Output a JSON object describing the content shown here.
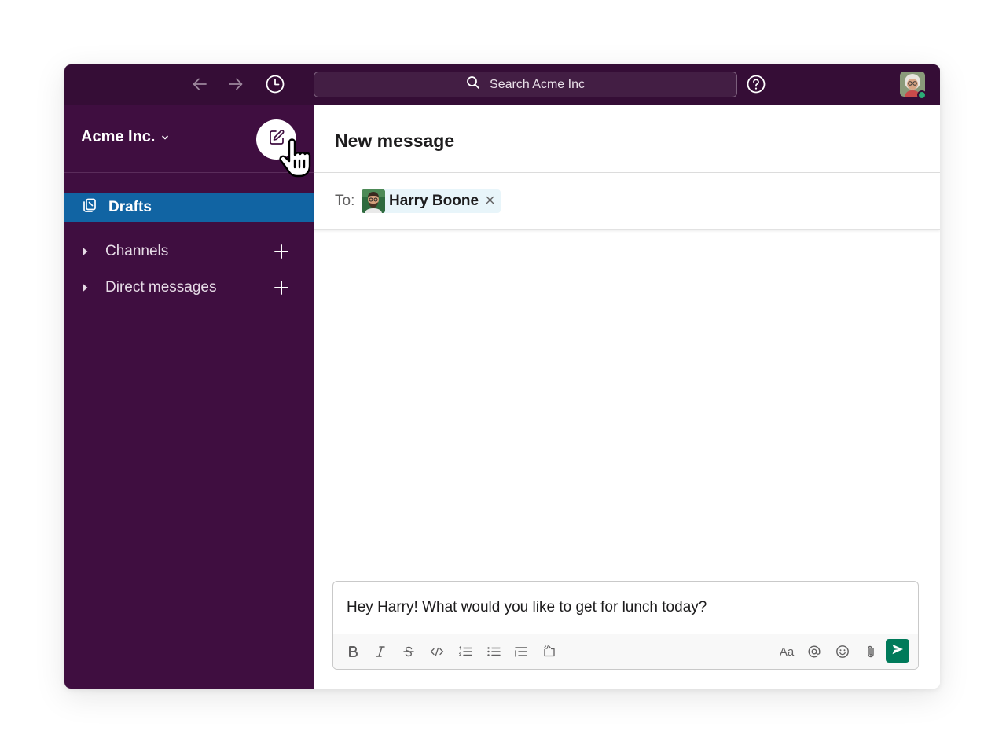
{
  "colors": {
    "topbar": "#350d36",
    "sidebar": "#3f0e40",
    "active_item": "#1164a3",
    "send_button": "#007a5a",
    "presence": "#2bac76",
    "chip_bg": "#e8f5fa"
  },
  "topbar": {
    "back_icon": "arrow-left-icon",
    "forward_icon": "arrow-right-icon",
    "history_icon": "clock-icon",
    "search_placeholder": "Search Acme Inc",
    "help_icon": "question-circle-icon",
    "user_status": "online"
  },
  "sidebar": {
    "workspace_name": "Acme Inc.",
    "compose_icon": "edit-icon",
    "active_item": {
      "label": "Drafts",
      "icon": "drafts-icon"
    },
    "sections": [
      {
        "label": "Channels",
        "expanded": false
      },
      {
        "label": "Direct messages",
        "expanded": false
      }
    ]
  },
  "main": {
    "title": "New message",
    "to_label": "To:",
    "recipient": {
      "name": "Harry Boone"
    },
    "composer": {
      "text": "Hey Harry! What would you like to get for lunch today?",
      "format_tools": [
        "bold-icon",
        "italic-icon",
        "strikethrough-icon",
        "code-icon",
        "ordered-list-icon",
        "bulleted-list-icon",
        "blockquote-icon",
        "code-block-icon"
      ],
      "format_toggle_label": "Aa",
      "right_tools": [
        "mention-icon",
        "emoji-icon",
        "attachment-icon"
      ],
      "send_icon": "send-icon"
    }
  }
}
